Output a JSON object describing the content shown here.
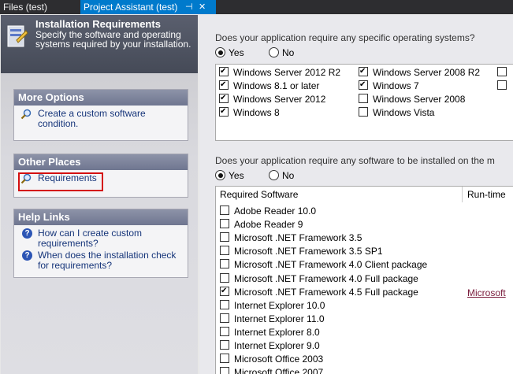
{
  "tabs": {
    "files_tab": "Files (test)",
    "assistant_tab": "Project Assistant (test)",
    "pin_glyph": "⊣",
    "close_glyph": "✕"
  },
  "banner": {
    "title": "Installation Requirements",
    "description": "Specify the software and operating systems required by your installation."
  },
  "more_options": {
    "title": "More Options",
    "item": "Create a custom software condition."
  },
  "other_places": {
    "title": "Other Places",
    "item": "Requirements"
  },
  "help_links": {
    "title": "Help Links",
    "items": [
      "How can I create custom requirements?",
      "When does the installation check for requirements?"
    ],
    "icon_glyph": "?"
  },
  "os_section": {
    "question": "Does your application require any specific operating systems?",
    "yes": "Yes",
    "no": "No",
    "selected": "Yes",
    "items": [
      {
        "label": "Windows Server 2012 R2",
        "checked": true
      },
      {
        "label": "Windows 8.1 or later",
        "checked": true
      },
      {
        "label": "Windows Server 2012",
        "checked": true
      },
      {
        "label": "Windows 8",
        "checked": true
      },
      {
        "label": "Windows Server 2008 R2",
        "checked": true
      },
      {
        "label": "Windows 7",
        "checked": true
      },
      {
        "label": "Windows Server 2008",
        "checked": false
      },
      {
        "label": "Windows Vista",
        "checked": false
      }
    ]
  },
  "sw_section": {
    "question": "Does your application require any software to be installed on the m",
    "yes": "Yes",
    "no": "No",
    "selected": "Yes",
    "col_software": "Required Software",
    "col_runtime": "Run-time",
    "items": [
      {
        "label": "Adobe Reader 10.0",
        "checked": false,
        "runtime": ""
      },
      {
        "label": "Adobe Reader 9",
        "checked": false,
        "runtime": ""
      },
      {
        "label": "Microsoft .NET Framework 3.5",
        "checked": false,
        "runtime": ""
      },
      {
        "label": "Microsoft .NET Framework 3.5 SP1",
        "checked": false,
        "runtime": ""
      },
      {
        "label": "Microsoft .NET Framework 4.0 Client package",
        "checked": false,
        "runtime": ""
      },
      {
        "label": "Microsoft .NET Framework 4.0 Full package",
        "checked": false,
        "runtime": ""
      },
      {
        "label": "Microsoft .NET Framework 4.5 Full package",
        "checked": true,
        "runtime": "Microsoft"
      },
      {
        "label": "Internet Explorer 10.0",
        "checked": false,
        "runtime": ""
      },
      {
        "label": "Internet Explorer 11.0",
        "checked": false,
        "runtime": ""
      },
      {
        "label": "Internet Explorer 8.0",
        "checked": false,
        "runtime": ""
      },
      {
        "label": "Internet Explorer 9.0",
        "checked": false,
        "runtime": ""
      },
      {
        "label": "Microsoft Office 2003",
        "checked": false,
        "runtime": ""
      },
      {
        "label": "Microsoft Office 2007",
        "checked": false,
        "runtime": ""
      }
    ]
  },
  "colors": {
    "accent_tab": "#007acc",
    "link": "#7a1c3c",
    "highlight_border": "#d41010"
  }
}
